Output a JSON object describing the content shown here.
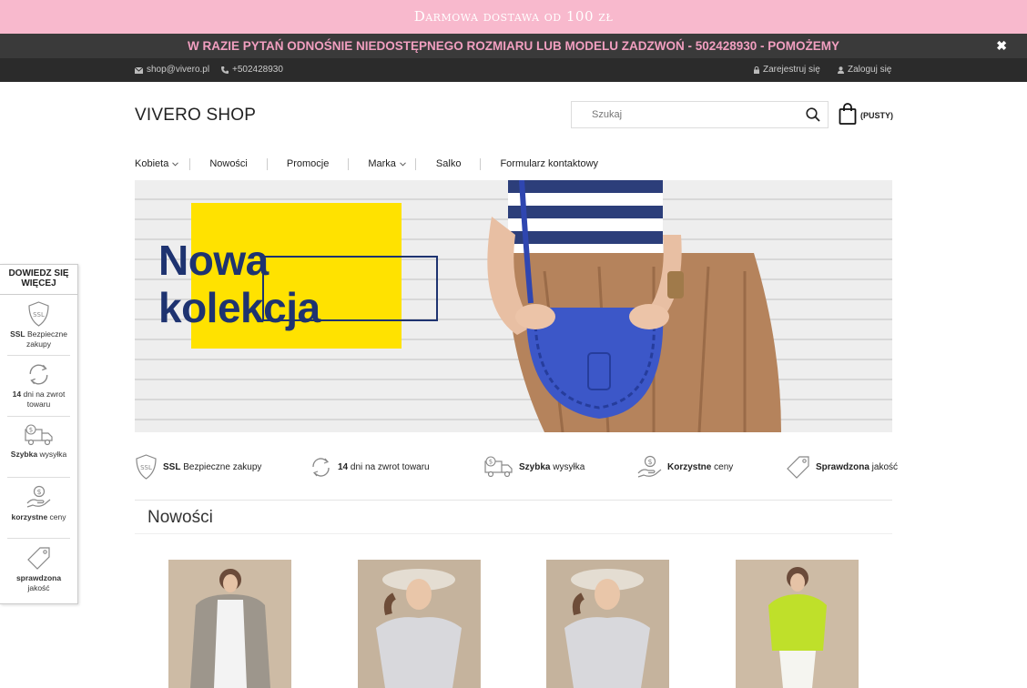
{
  "promo": {
    "text": "Darmowa dostawa od 100 zł"
  },
  "alert": {
    "text": "W RAZIE PYTAŃ ODNOŚNIE NIEDOSTĘPNEGO ROZMIARU LUB MODELU ZADZWOŃ -  502428930 - POMOŻEMY",
    "close": "✖"
  },
  "topbar": {
    "email": "shop@vivero.pl",
    "phone": "+502428930",
    "register": "Zarejestruj się",
    "login": "Zaloguj się"
  },
  "header": {
    "logo": "VIVERO SHOP",
    "search_placeholder": "Szukaj",
    "cart_label": "(PUSTY)"
  },
  "nav": {
    "items": [
      "Kobieta",
      "Nowości",
      "Promocje",
      "Marka",
      "Salko",
      "Formularz kontaktowy"
    ]
  },
  "hero": {
    "line1": "Nowa",
    "line2": "kolekcja"
  },
  "features": [
    {
      "bold": "SSL",
      "rest": " Bezpieczne zakupy",
      "icon": "ssl-shield-icon"
    },
    {
      "bold": "14",
      "rest": " dni na zwrot towaru",
      "icon": "return-arrows-icon"
    },
    {
      "bold": "Szybka",
      "rest": " wysyłka",
      "icon": "delivery-truck-icon"
    },
    {
      "bold": "Korzystne",
      "rest": " ceny",
      "icon": "hand-money-icon"
    },
    {
      "bold": "Sprawdzona",
      "rest": " jakość",
      "icon": "price-tag-icon"
    }
  ],
  "section": {
    "title": "Nowości"
  },
  "sidebar": {
    "title": "DOWIEDZ SIĘ WIĘCEJ",
    "items": [
      {
        "bold": "SSL",
        "rest": " Bezpieczne zakupy"
      },
      {
        "bold": "14",
        "rest": " dni na zwrot towaru"
      },
      {
        "bold": "Szybka",
        "rest": " wysyłka"
      },
      {
        "bold": "korzystne",
        "rest": " ceny"
      },
      {
        "bold": "sprawdzona",
        "rest": " jakość"
      }
    ]
  },
  "colors": {
    "promo_bg": "#f8b9cd",
    "alert_text": "#f29fc0",
    "hero_yellow": "#ffe200",
    "hero_navy": "#1e3370"
  }
}
